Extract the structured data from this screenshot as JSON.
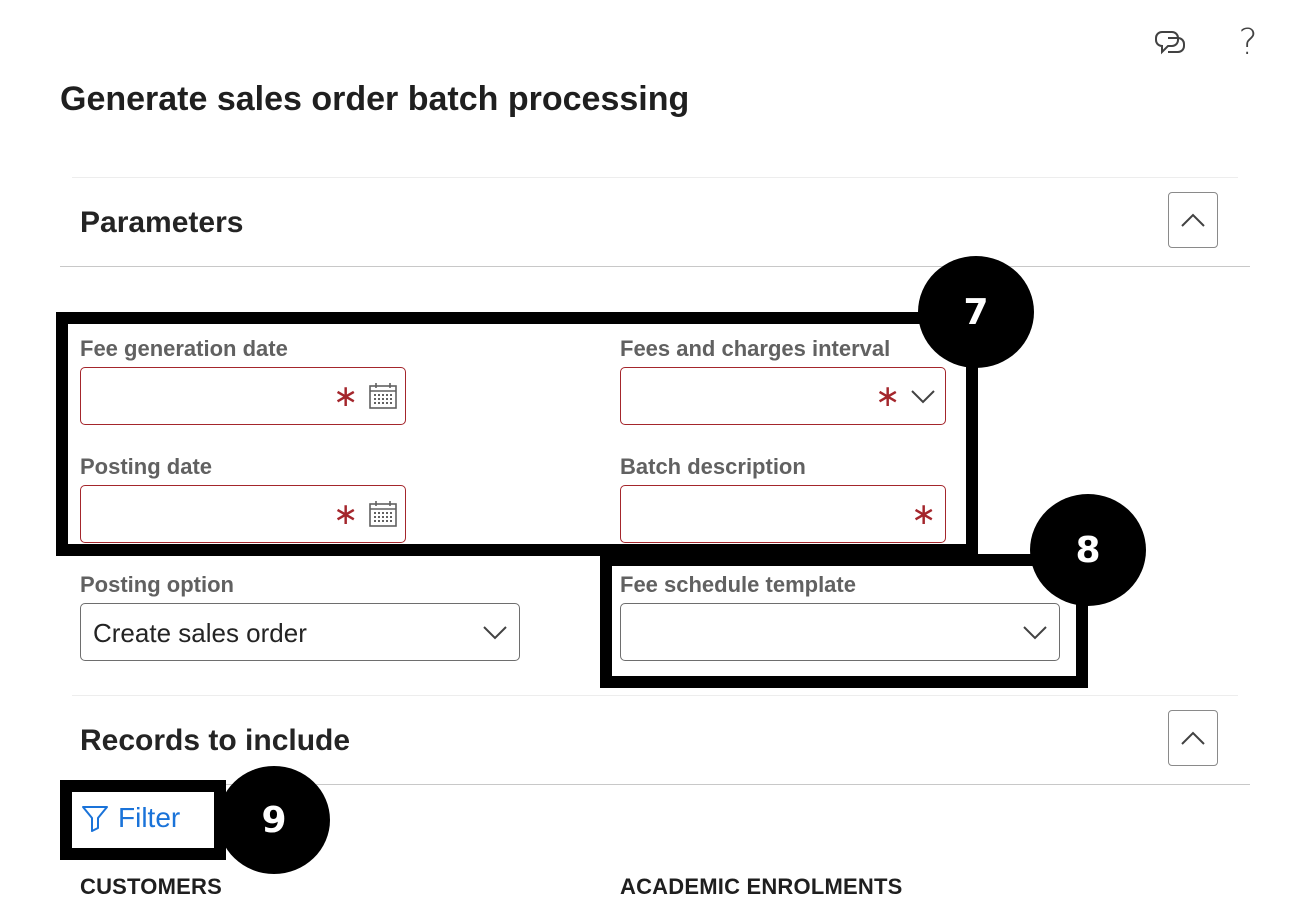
{
  "page": {
    "title": "Generate sales order batch processing"
  },
  "header_icons": {
    "copilot": "copilot-icon",
    "help": "?"
  },
  "parameters": {
    "section_title": "Parameters",
    "fee_generation_date": {
      "label": "Fee generation date",
      "value": "",
      "required": true
    },
    "fees_and_charges_interval": {
      "label": "Fees and charges interval",
      "value": "",
      "required": true
    },
    "posting_date": {
      "label": "Posting date",
      "value": "",
      "required": true
    },
    "batch_description": {
      "label": "Batch description",
      "value": "",
      "required": true
    },
    "posting_option": {
      "label": "Posting option",
      "value": "Create sales order"
    },
    "fee_schedule_template": {
      "label": "Fee schedule template",
      "value": ""
    }
  },
  "records": {
    "section_title": "Records to include",
    "filter_label": "Filter",
    "columns": [
      "CUSTOMERS",
      "ACADEMIC ENROLMENTS"
    ]
  },
  "annotations": {
    "badge_7": "7",
    "badge_8": "8",
    "badge_9": "9"
  },
  "colors": {
    "required_border": "#a4262c",
    "link_blue": "#1a73d9",
    "annotation": "#000000"
  }
}
